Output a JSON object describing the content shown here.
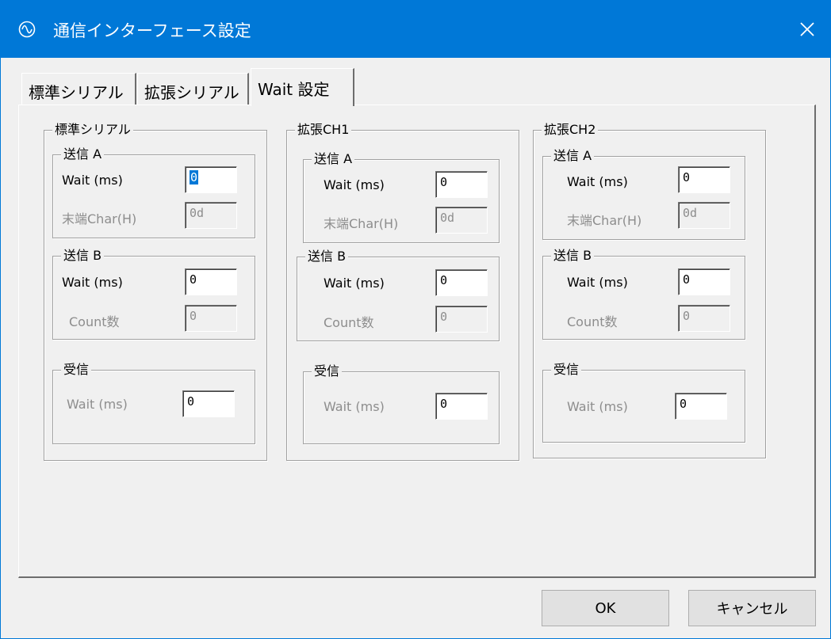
{
  "window": {
    "title": "通信インターフェース設定",
    "title_icon": "waveform-circle-icon",
    "close_icon": "close-x-icon"
  },
  "tabs": [
    {
      "label": "標準シリアル",
      "active": false
    },
    {
      "label": "拡張シリアル",
      "active": false
    },
    {
      "label": "Wait 設定",
      "active": true
    }
  ],
  "groups": [
    {
      "label": "標準シリアル",
      "send_a": {
        "label": "送信 A",
        "wait_label": "Wait (ms)",
        "wait_value_selected": "0",
        "end_char_label": "末端Char(H)",
        "end_char_value": "0d"
      },
      "send_b": {
        "label": "送信 B",
        "wait_label": "Wait (ms)",
        "wait_value": "0",
        "count_label": "Count数",
        "count_value": "0"
      },
      "receive": {
        "label": "受信",
        "wait_label": "Wait (ms)",
        "wait_value": "0"
      }
    },
    {
      "label": "拡張CH1",
      "send_a": {
        "label": "送信 A",
        "wait_label": "Wait (ms)",
        "wait_value": "0",
        "end_char_label": "末端Char(H)",
        "end_char_value": "0d"
      },
      "send_b": {
        "label": "送信 B",
        "wait_label": "Wait (ms)",
        "wait_value": "0",
        "count_label": "Count数",
        "count_value": "0"
      },
      "receive": {
        "label": "受信",
        "wait_label": "Wait (ms)",
        "wait_value": "0"
      }
    },
    {
      "label": "拡張CH2",
      "send_a": {
        "label": "送信 A",
        "wait_label": "Wait (ms)",
        "wait_value": "0",
        "end_char_label": "末端Char(H)",
        "end_char_value": "0d"
      },
      "send_b": {
        "label": "送信 B",
        "wait_label": "Wait (ms)",
        "wait_value": "0",
        "count_label": "Count数",
        "count_value": "0"
      },
      "receive": {
        "label": "受信",
        "wait_label": "Wait (ms)",
        "wait_value": "0"
      }
    }
  ],
  "buttons": {
    "ok": "OK",
    "cancel": "キャンセル"
  },
  "colors": {
    "titlebar": "#0078d7",
    "selection": "#0078d7",
    "disabled_text": "#8d8d8d"
  }
}
